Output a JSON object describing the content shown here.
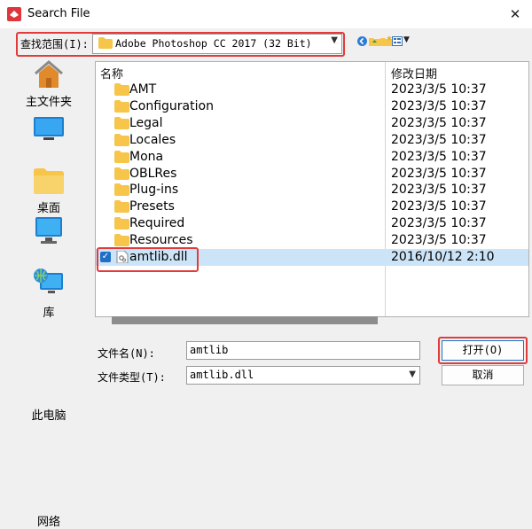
{
  "window": {
    "title": "Search File",
    "close_glyph": "✕"
  },
  "lookin": {
    "label": "查找范围(I):",
    "value": "Adobe Photoshop CC 2017 (32 Bit)"
  },
  "places": [
    {
      "label": "主文件夹",
      "icon": "home-icon"
    },
    {
      "label": "桌面",
      "icon": "desktop-icon"
    },
    {
      "label": "库",
      "icon": "library-folder-icon"
    },
    {
      "label": "此电脑",
      "icon": "computer-icon"
    },
    {
      "label": "网络",
      "icon": "network-icon"
    }
  ],
  "filelist": {
    "columns": {
      "name": "名称",
      "date": "修改日期"
    },
    "rows": [
      {
        "name": "AMT",
        "date": "2023/3/5 10:37",
        "type": "folder"
      },
      {
        "name": "Configuration",
        "date": "2023/3/5 10:37",
        "type": "folder"
      },
      {
        "name": "Legal",
        "date": "2023/3/5 10:37",
        "type": "folder"
      },
      {
        "name": "Locales",
        "date": "2023/3/5 10:37",
        "type": "folder"
      },
      {
        "name": "Mona",
        "date": "2023/3/5 10:37",
        "type": "folder"
      },
      {
        "name": "OBLRes",
        "date": "2023/3/5 10:37",
        "type": "folder"
      },
      {
        "name": "Plug-ins",
        "date": "2023/3/5 10:37",
        "type": "folder"
      },
      {
        "name": "Presets",
        "date": "2023/3/5 10:37",
        "type": "folder"
      },
      {
        "name": "Required",
        "date": "2023/3/5 10:37",
        "type": "folder"
      },
      {
        "name": "Resources",
        "date": "2023/3/5 10:37",
        "type": "folder"
      },
      {
        "name": "amtlib.dll",
        "date": "2016/10/12 2:10",
        "type": "file",
        "selected": true
      }
    ]
  },
  "filename": {
    "label": "文件名(N):",
    "value": "amtlib"
  },
  "filetype": {
    "label": "文件类型(T):",
    "value": "amtlib.dll"
  },
  "buttons": {
    "open": "打开(O)",
    "cancel": "取消"
  },
  "colors": {
    "highlight": "#e23b3b",
    "selection": "#cce4f7",
    "folder": "#f6c54a"
  }
}
